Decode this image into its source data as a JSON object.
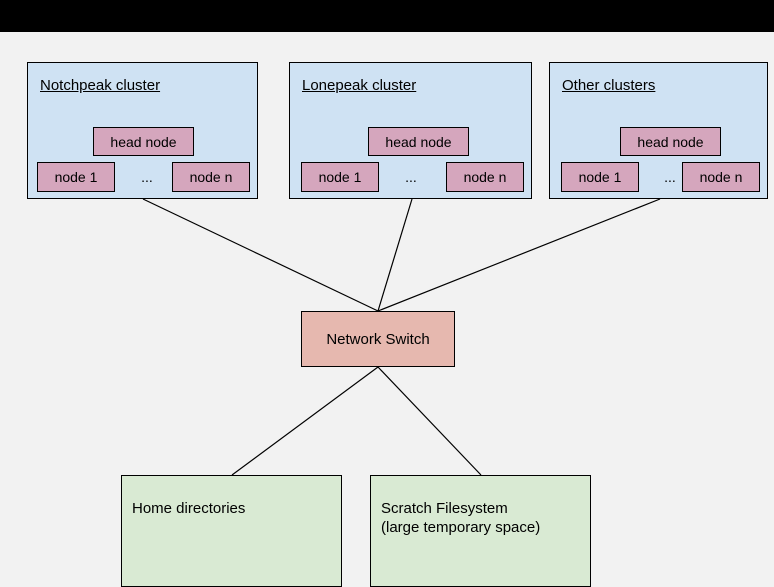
{
  "diagram": {
    "background_color": "#f2f2f2",
    "topbar_color": "#000000",
    "colors": {
      "cluster_fill": "#cfe2f3",
      "node_fill": "#d5a6bd",
      "switch_fill": "#e6b8af",
      "storage_fill": "#d9ead3",
      "stroke": "#000000"
    },
    "clusters": [
      {
        "title": "Notchpeak cluster",
        "head_node": "head node",
        "first_node": "node 1",
        "ellipsis": "...",
        "last_node": "node n"
      },
      {
        "title": "Lonepeak cluster",
        "head_node": "head node",
        "first_node": "node 1",
        "ellipsis": "...",
        "last_node": "node n"
      },
      {
        "title": "Other clusters",
        "head_node": "head node",
        "first_node": "node 1",
        "ellipsis": "...",
        "last_node": "node n"
      }
    ],
    "switch": {
      "label": "Network Switch"
    },
    "storage": [
      {
        "label": "Home directories"
      },
      {
        "label": "Scratch Filesystem\n(large temporary space)"
      }
    ]
  }
}
